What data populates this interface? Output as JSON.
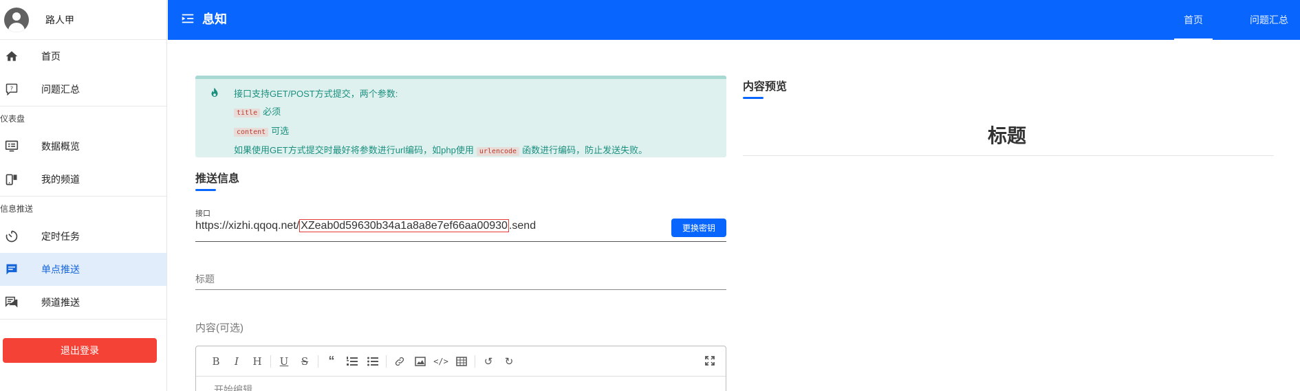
{
  "sidebar": {
    "user_name": "路人甲",
    "items": [
      {
        "label": "首页",
        "icon": "home-icon"
      },
      {
        "label": "问题汇总",
        "icon": "question-icon"
      }
    ],
    "section_dashboard": "仪表盘",
    "dashboard_items": [
      {
        "label": "数据概览",
        "icon": "monitor-icon"
      },
      {
        "label": "我的频道",
        "icon": "devices-icon"
      }
    ],
    "section_push": "信息推送",
    "push_items": [
      {
        "label": "定时任务",
        "icon": "timer-icon"
      },
      {
        "label": "单点推送",
        "icon": "message-icon",
        "active": true
      },
      {
        "label": "频道推送",
        "icon": "messages-icon"
      }
    ],
    "logout_label": "退出登录"
  },
  "topbar": {
    "brand": "息知",
    "links": [
      "首页",
      "问题汇总"
    ],
    "active_link": "首页"
  },
  "alert": {
    "line1": "接口支持GET/POST方式提交，两个参数:",
    "param1_code": "title",
    "param1_text": "必须",
    "param2_code": "content",
    "param2_text": "可选",
    "line4_before": "如果使用GET方式提交时最好将参数进行url编码，如php使用",
    "line4_code": "urlencode",
    "line4_after": "函数进行编码，防止发送失败。"
  },
  "push_info": {
    "title": "推送信息",
    "endpoint_label": "接口",
    "url_prefix": "https://xizhi.qqoq.net/",
    "url_key": "XZeab0d59630b34a1a8a8e7ef66aa00930",
    "url_suffix": ".send",
    "change_key_label": "更换密钥",
    "title_placeholder": "标题",
    "content_placeholder": "内容(可选)",
    "editor_placeholder": "开始编辑..."
  },
  "preview": {
    "title": "内容预览",
    "heading": "标题"
  },
  "colors": {
    "primary": "#0866ff",
    "danger": "#f44336",
    "alert_bg": "#dff1ef",
    "alert_text": "#1a8f7e"
  }
}
